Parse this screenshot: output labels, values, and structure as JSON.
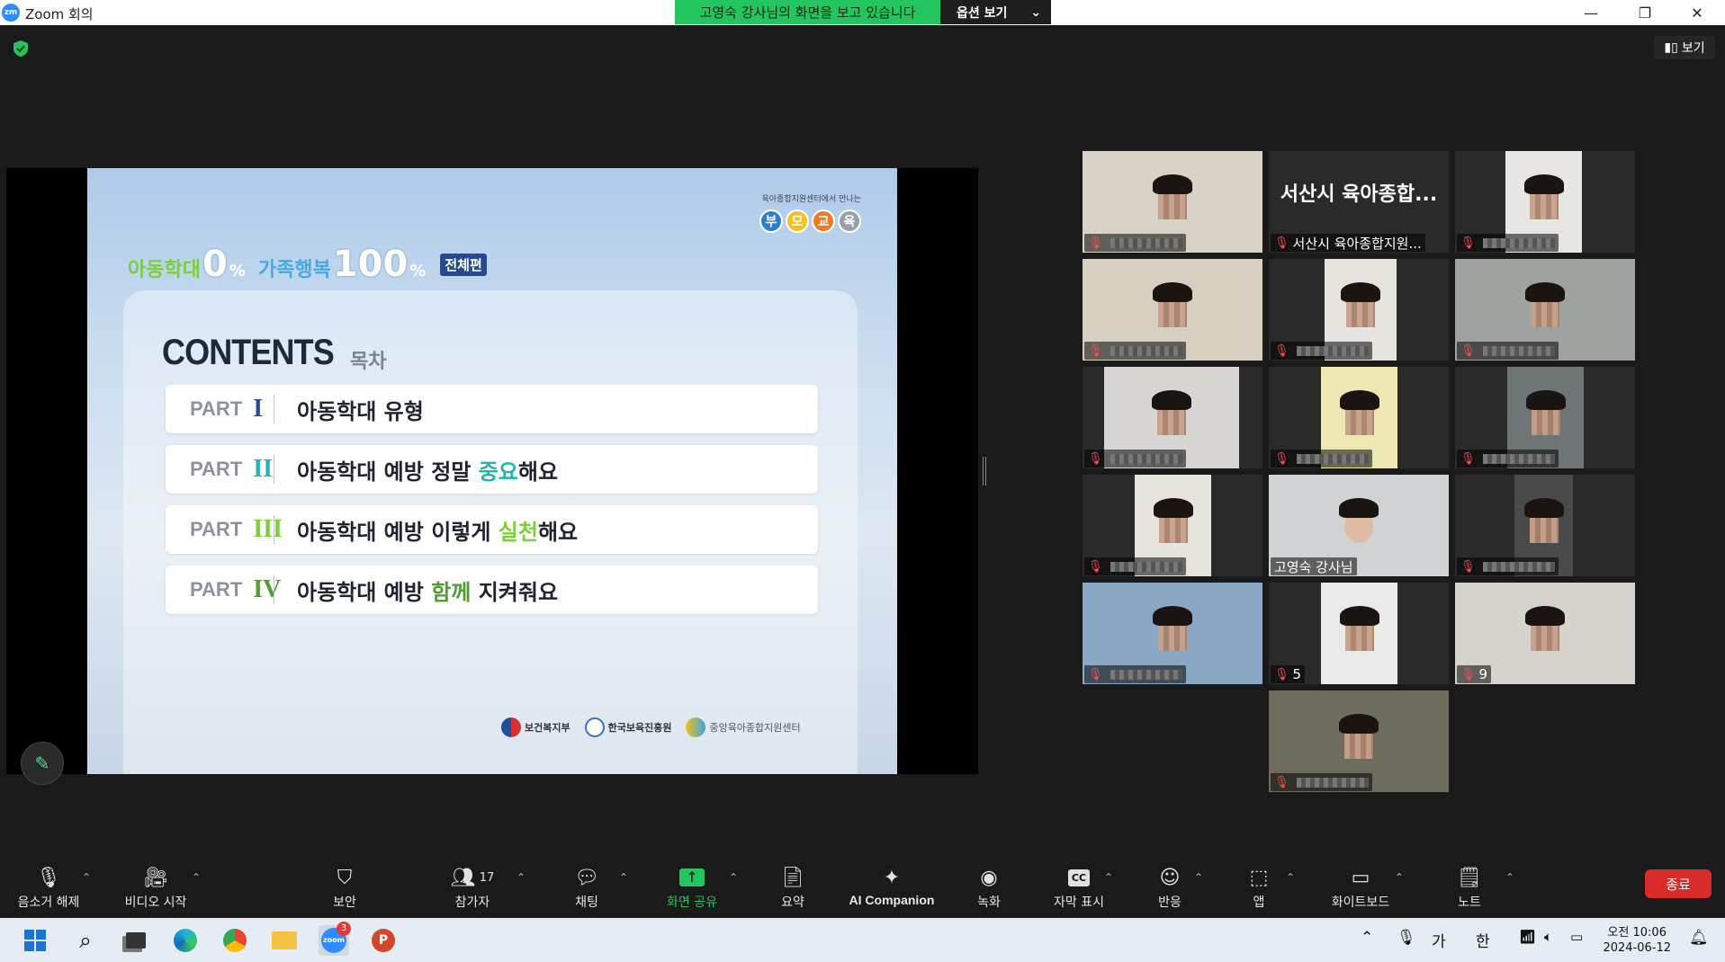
{
  "window": {
    "title": "Zoom 회의",
    "logo_text": "zm"
  },
  "banner": {
    "sharing_text": "고영숙 강사님의 화면을 보고 있습니다",
    "options_label": "옵션 보기"
  },
  "top_right": {
    "view_label": "보기"
  },
  "slide": {
    "top_sub": "육아종합지원센터에서 만나는",
    "top_logo_chars": [
      "부",
      "모",
      "교",
      "육"
    ],
    "headline_part1": "아동학대",
    "headline_zero": "0",
    "headline_pct": "%",
    "headline_part2": "가족행복",
    "headline_hundred": "100",
    "headline_badge": "전체편",
    "contents_title": "CONTENTS",
    "contents_sub": "목차",
    "toc": [
      {
        "part": "PART",
        "num": "I",
        "num_color": "#2d4a8a",
        "pre": "아동학대 유형",
        "hl": "",
        "post": "",
        "hl_color": "#1e2430"
      },
      {
        "part": "PART",
        "num": "II",
        "num_color": "#22b3b3",
        "pre": "아동학대 예방 정말 ",
        "hl": "중요",
        "post": "해요",
        "hl_color": "#22b3b3"
      },
      {
        "part": "PART",
        "num": "III",
        "num_color": "#7ccf3c",
        "pre": "아동학대 예방 이렇게 ",
        "hl": "실천",
        "post": "해요",
        "hl_color": "#7ccf3c"
      },
      {
        "part": "PART",
        "num": "IV",
        "num_color": "#4f9e32",
        "pre": "아동학대 예방 ",
        "hl": "함께",
        "post": " 지켜줘요",
        "hl_color": "#4f9e32"
      }
    ],
    "footer": [
      "보건복지부",
      "한국보육진흥원",
      "중앙육아종합지원센터"
    ]
  },
  "participants": [
    {
      "name": "",
      "muted": true
    },
    {
      "name": "서산시 육아종합지원...",
      "display_name": "서산시 육아종합...",
      "muted": true
    },
    {
      "name": "",
      "muted": true
    },
    {
      "name": "",
      "muted": true
    },
    {
      "name": "",
      "muted": true
    },
    {
      "name": "",
      "muted": true
    },
    {
      "name": "",
      "muted": true
    },
    {
      "name": "",
      "muted": true
    },
    {
      "name": "",
      "muted": true
    },
    {
      "name": "",
      "muted": true
    },
    {
      "name": "고영숙 강사님",
      "muted": false,
      "active": true
    },
    {
      "name": "",
      "muted": true
    },
    {
      "name": "",
      "muted": true
    },
    {
      "name": "5",
      "muted": true
    },
    {
      "name": "9",
      "muted": true
    },
    {
      "name": "",
      "muted": true
    }
  ],
  "toolbar": {
    "mute": "음소거 해제",
    "video": "비디오 시작",
    "security": "보안",
    "participants": "참가자",
    "participants_count": "17",
    "chat": "채팅",
    "share": "화면 공유",
    "summary": "요약",
    "ai": "AI Companion",
    "record": "녹화",
    "captions": "자막 표시",
    "captions_icon": "CC",
    "reactions": "반응",
    "apps": "앱",
    "whiteboard": "화이트보드",
    "notes": "노트",
    "end": "종료"
  },
  "taskbar": {
    "zoom_badge": "3",
    "ime1": "가",
    "ime2": "한",
    "time": "오전 10:06",
    "date": "2024-06-12"
  },
  "colors": {
    "share_green": "#22c55e",
    "end_red": "#d92b2b",
    "active_outline": "#b6e34a",
    "mute_red": "#ff4d4f"
  }
}
